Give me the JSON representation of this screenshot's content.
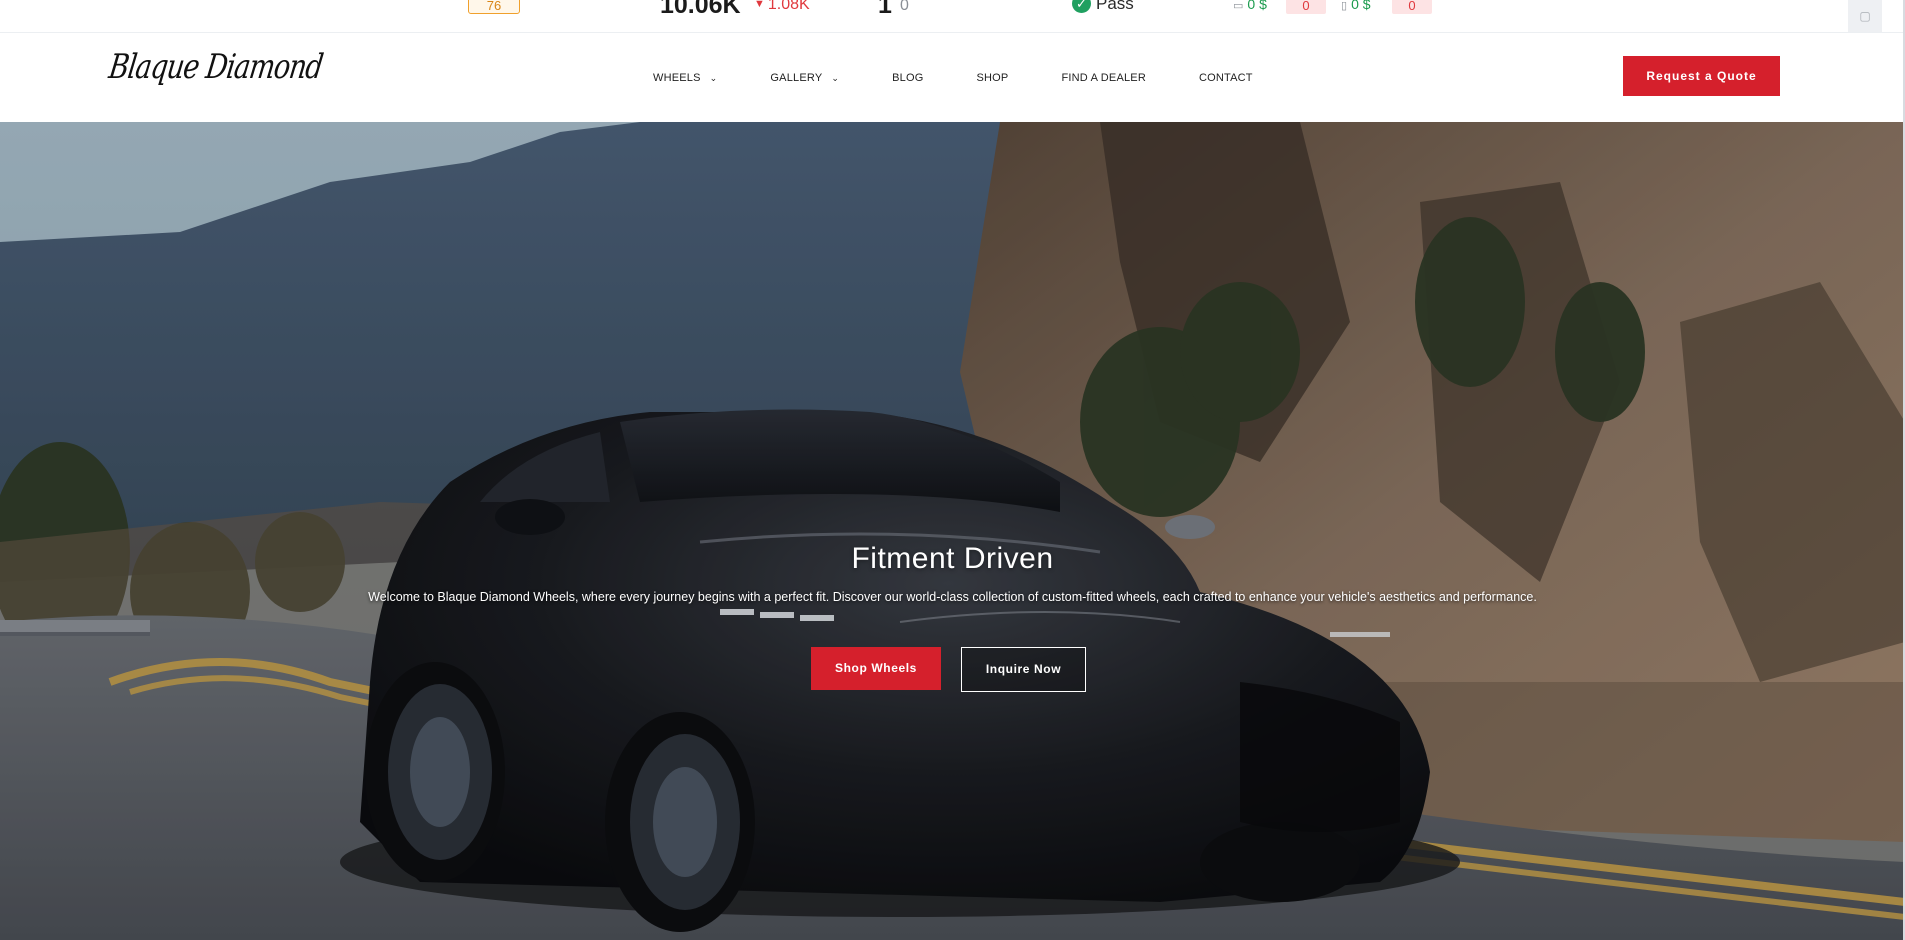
{
  "seo_toolbar": {
    "score": "76",
    "traffic": "10.06K",
    "traffic_delta": "1.08K",
    "keywords": "1",
    "keywords_delta": "0",
    "status": "Pass",
    "desktop_value": "0 $",
    "desktop_count": "0",
    "mobile_value": "0 $",
    "mobile_count": "0",
    "icons": {
      "trend_down": "triangle-down-icon",
      "status": "check-circle-icon",
      "desktop": "monitor-icon",
      "mobile": "phone-icon",
      "corner": "square-icon"
    }
  },
  "header": {
    "logo_text": "Blaque Diamond",
    "nav": [
      {
        "label": "WHEELS",
        "has_dropdown": true
      },
      {
        "label": "GALLERY",
        "has_dropdown": true
      },
      {
        "label": "BLOG",
        "has_dropdown": false
      },
      {
        "label": "SHOP",
        "has_dropdown": false
      },
      {
        "label": "FIND A DEALER",
        "has_dropdown": false
      },
      {
        "label": "CONTACT",
        "has_dropdown": false
      }
    ],
    "cta_label": "Request a Quote"
  },
  "hero": {
    "title": "Fitment Driven",
    "subtitle": "Welcome to Blaque Diamond Wheels, where every journey begins with a perfect fit. Discover our world-class collection of custom-fitted wheels, each crafted to enhance your vehicle's aesthetics and performance.",
    "primary_button": "Shop Wheels",
    "secondary_button": "Inquire Now"
  },
  "colors": {
    "brand_red": "#d5202c",
    "seo_green": "#1c9b4e",
    "seo_red": "#e0393e",
    "seo_orange": "#f0a02c"
  }
}
